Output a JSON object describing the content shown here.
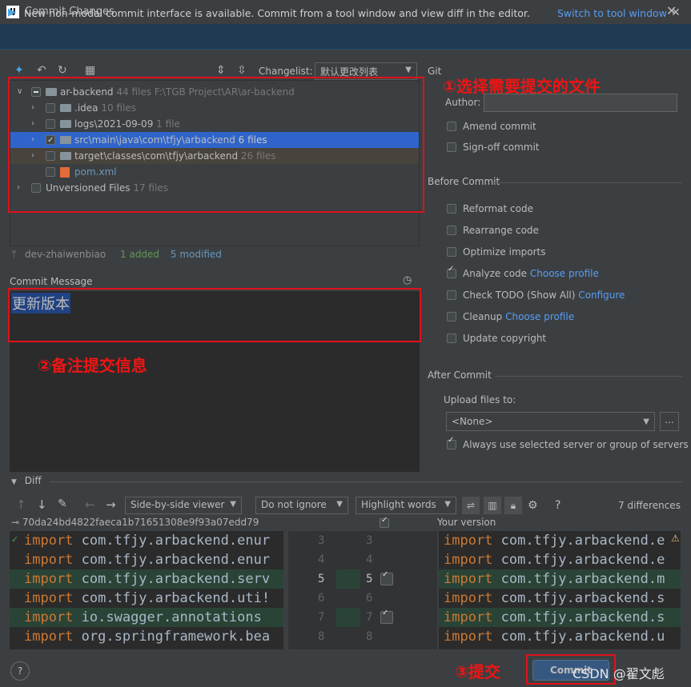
{
  "window": {
    "title": "Commit Changes",
    "app_icon": "IJ"
  },
  "notification": {
    "text": "New non-modal commit interface is available. Commit from a tool window and view diff in the editor.",
    "link": "Switch to tool window"
  },
  "toolbar": {
    "changelist_label": "Changelist:",
    "changelist_value": "默认更改列表"
  },
  "tree": {
    "root": {
      "name": "ar-backend",
      "count": "44 files",
      "path": "F:\\TGB Project\\AR\\ar-backend"
    },
    "items": [
      {
        "name": ".idea",
        "count": "10 files"
      },
      {
        "name": "logs\\2021-09-09",
        "count": "1 file"
      },
      {
        "name": "src\\main\\java\\com\\tfjy\\arbackend",
        "count": "6 files"
      },
      {
        "name": "target\\classes\\com\\tfjy\\arbackend",
        "count": "26 files"
      },
      {
        "name": "pom.xml",
        "count": ""
      }
    ],
    "unversioned": {
      "name": "Unversioned Files",
      "count": "17 files"
    }
  },
  "branch": {
    "name": "dev-zhaiwenbiao",
    "added": "1 added",
    "modified": "5 modified"
  },
  "commit_message": {
    "label": "Commit Message",
    "value": "更新版本"
  },
  "annotations": {
    "step1": "①选择需要提交的文件",
    "step2": "②备注提交信息",
    "step3": "③提交"
  },
  "git": {
    "label": "Git",
    "author_label": "Author:",
    "amend": "Amend commit",
    "signoff": "Sign-off commit"
  },
  "before_commit": {
    "title": "Before Commit",
    "reformat": "Reformat code",
    "rearrange": "Rearrange code",
    "optimize": "Optimize imports",
    "analyze": "Analyze code",
    "analyze_link": "Choose profile",
    "todo": "Check TODO (Show All)",
    "todo_link": "Configure",
    "cleanup": "Cleanup",
    "cleanup_link": "Choose profile",
    "copyright": "Update copyright"
  },
  "after_commit": {
    "title": "After Commit",
    "upload_label": "Upload files to:",
    "upload_value": "<None>",
    "browse": "...",
    "always": "Always use selected server or group of servers"
  },
  "diff": {
    "title": "Diff",
    "viewer": "Side-by-side viewer",
    "whitespace": "Do not ignore",
    "highlight": "Highlight words",
    "help": "?",
    "differences": "7 differences",
    "left_hash": "70da24bd4822faeca1b71651308e9f93a07edd79",
    "right_title": "Your version",
    "left_lines": [
      {
        "kw": "import",
        "rest": " com.tfjy.arbackend.enur"
      },
      {
        "kw": "import",
        "rest": " com.tfjy.arbackend.enur"
      },
      {
        "kw": "import",
        "rest": " com.tfjy.arbackend.serv"
      },
      {
        "kw": "import",
        "rest": " com.tfjy.arbackend.uti!"
      },
      {
        "kw": "import",
        "rest": " io.swagger.annotations"
      },
      {
        "kw": "import",
        "rest": " org.springframework.bea"
      }
    ],
    "right_lines": [
      {
        "kw": "import",
        "rest": " com.tfjy.arbackend.e"
      },
      {
        "kw": "import",
        "rest": " com.tfjy.arbackend.e"
      },
      {
        "kw": "import",
        "rest": " com.tfjy.arbackend.m"
      },
      {
        "kw": "import",
        "rest": " com.tfjy.arbackend.s"
      },
      {
        "kw": "import",
        "rest": " com.tfjy.arbackend.s"
      },
      {
        "kw": "import",
        "rest": " com.tfjy.arbackend.u"
      }
    ],
    "left_nums": [
      "3",
      "4",
      "5",
      "6",
      "7",
      "8"
    ],
    "right_nums": [
      "3",
      "4",
      "5",
      "6",
      "7",
      "8"
    ]
  },
  "footer": {
    "help": "?",
    "commit": "Commit",
    "watermark": "CSDN @翟文彪"
  },
  "colors": {
    "accent": "#2f65ca",
    "annotation": "#e0111b",
    "link": "#589df6"
  }
}
